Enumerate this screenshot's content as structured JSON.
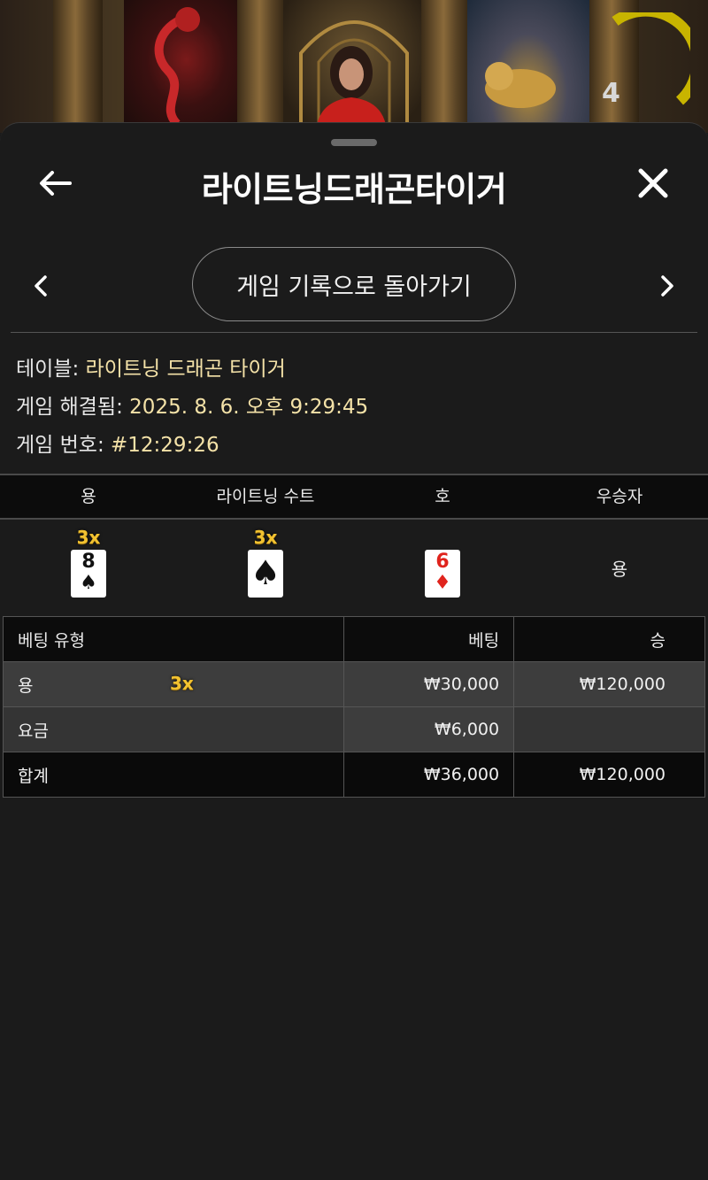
{
  "timer": {
    "count": "4"
  },
  "header": {
    "title": "라이트닝드래곤타이거",
    "history_button": "게임 기록으로 돌아가기"
  },
  "info": {
    "table_label": "테이블: ",
    "table_value": "라이트닝 드래곤 타이거",
    "resolved_label": "게임 해결됨: ",
    "resolved_value": "2025. 8. 6. 오후 9:29:45",
    "number_label": "게임 번호: ",
    "number_value": "#12:29:26"
  },
  "result": {
    "headers": [
      "용",
      "라이트닝 수트",
      "호",
      "우승자"
    ],
    "dragon": {
      "multiplier": "3x",
      "rank": "8",
      "suit": "♠"
    },
    "lightning": {
      "multiplier": "3x",
      "suit": "♠"
    },
    "tiger": {
      "rank": "6",
      "suit": "♦"
    },
    "winner": "용"
  },
  "bets": {
    "headers": {
      "type": "베팅 유형",
      "bet": "베팅",
      "win": "승"
    },
    "rows": [
      {
        "type": "용",
        "multiplier": "3x",
        "bet": "₩30,000",
        "win": "₩120,000"
      },
      {
        "type": "요금",
        "bet": "₩6,000",
        "win": ""
      },
      {
        "type": "합계",
        "bet": "₩36,000",
        "win": "₩120,000"
      }
    ]
  },
  "colors": {
    "accent_gold": "#f2c230",
    "value_text": "#f4e2a8",
    "timer_ring": "#c8b400"
  },
  "icons": {
    "back": "back-arrow-icon",
    "close": "close-icon",
    "prev": "chevron-left-icon",
    "next": "chevron-right-icon"
  }
}
